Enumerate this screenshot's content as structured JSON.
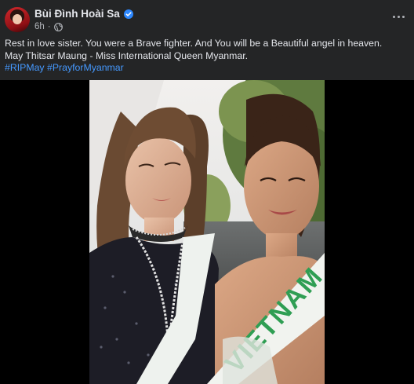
{
  "post": {
    "author": "Bùi Đình Hoài Sa",
    "time": "6h",
    "separator": "·",
    "text_line1": "Rest in love sister. You were a Brave fighter. And You will be a Beautiful angel in heaven.",
    "text_line2": "May Thitsar Maung - Miss International Queen Myanmar.",
    "hashtags": [
      "#RIPMay",
      "#PrayforMyanmar"
    ],
    "sash_text": "VIETNAM"
  },
  "icons": {
    "verified": "verified-badge-icon",
    "privacy": "globe-icon",
    "menu": "more-options-icon"
  },
  "colors": {
    "background": "#242526",
    "link": "#4599ff",
    "verified": "#2d88ff",
    "secondary_text": "#b0b3b8"
  }
}
